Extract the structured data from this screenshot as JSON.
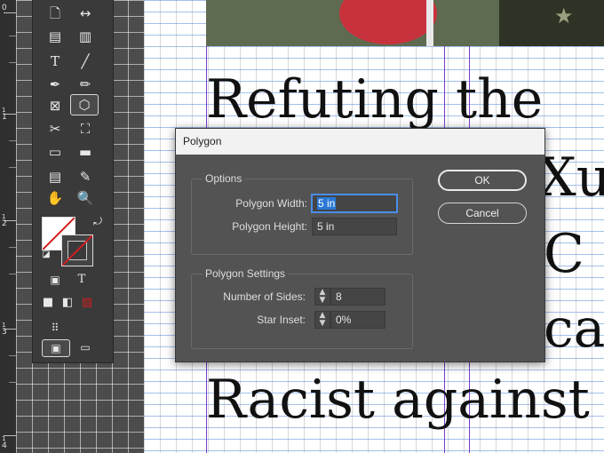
{
  "dialog": {
    "title": "Polygon",
    "options_group": {
      "title": "Options",
      "width_label": "Polygon Width:",
      "width_value": "5 in",
      "height_label": "Polygon Height:",
      "height_value": "5 in"
    },
    "settings_group": {
      "title": "Polygon Settings",
      "sides_label": "Number of Sides:",
      "sides_value": "8",
      "inset_label": "Star Inset:",
      "inset_value": "0%"
    },
    "ok_label": "OK",
    "cancel_label": "Cancel"
  },
  "document": {
    "line1": "Refuting the",
    "line2": "Xu",
    "line3": "C",
    "line4": "ca",
    "line5": "Racist against"
  },
  "ruler": {
    "labels": [
      "0",
      "1",
      "2",
      "3",
      "4"
    ]
  },
  "tools": {
    "icons": [
      "page-icon",
      "gap-icon",
      "content-collector-icon",
      "content-placer-icon",
      "type-icon",
      "line-icon",
      "pen-icon",
      "pencil-icon",
      "rectangle-frame-icon",
      "polygon-icon",
      "scissors-icon",
      "free-transform-icon",
      "gradient-swatch-icon",
      "gradient-feather-icon",
      "note-icon",
      "eyedropper-icon",
      "hand-icon",
      "zoom-icon"
    ]
  },
  "colors": {
    "accent_blue": "#2a78d6",
    "guide_purple": "#7a3ccc",
    "no_color_red": "#d21e1e"
  }
}
